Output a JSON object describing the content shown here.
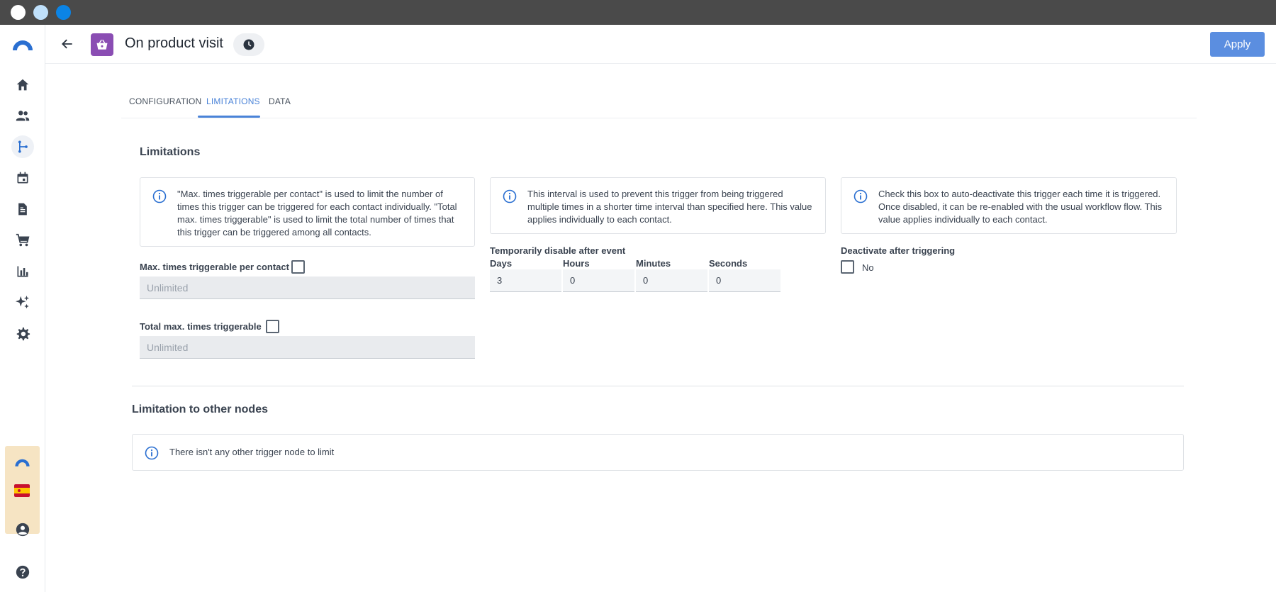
{
  "header": {
    "title": "On product visit",
    "apply_label": "Apply"
  },
  "tabs": [
    {
      "label": "CONFIGURATION",
      "active": false
    },
    {
      "label": "LIMITATIONS",
      "active": true
    },
    {
      "label": "DATA",
      "active": false
    }
  ],
  "limitations": {
    "title": "Limitations",
    "info_max_times": "\"Max. times triggerable per contact\" is used to limit the number of times this trigger can be triggered for each contact individually. \"Total max. times triggerable\" is used to limit the total number of times that this trigger can be triggered among all contacts.",
    "info_interval": "This interval is used to prevent this trigger from being triggered multiple times in a shorter time interval than specified here. This value applies individually to each contact.",
    "info_deactivate": "Check this box to auto-deactivate this trigger each time it is triggered. Once disabled, it can be re-enabled with the usual workflow flow. This value applies individually to each contact.",
    "max_per_contact_label": "Max. times triggerable per contact",
    "max_per_contact_placeholder": "Unlimited",
    "total_max_label": "Total max. times triggerable",
    "total_max_placeholder": "Unlimited",
    "temp_disable_label": "Temporarily disable after event",
    "days_label": "Days",
    "hours_label": "Hours",
    "minutes_label": "Minutes",
    "seconds_label": "Seconds",
    "days_value": "3",
    "hours_value": "0",
    "minutes_value": "0",
    "seconds_value": "0",
    "deactivate_label": "Deactivate after triggering",
    "deactivate_value_label": "No"
  },
  "other_nodes": {
    "title": "Limitation to other nodes",
    "info": "There isn't any other trigger node to limit"
  },
  "colors": {
    "accent": "#4a83d8",
    "apply": "#5b8ee0",
    "node_icon": "#8a4db3"
  }
}
